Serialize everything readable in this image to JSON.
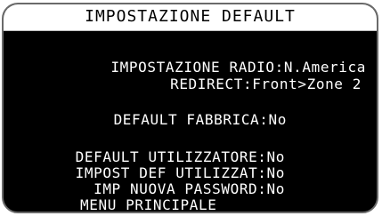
{
  "screen": {
    "title": "IMPOSTAZIONE DEFAULT",
    "items": [
      {
        "label": "IMPOSTAZIONE RADIO:",
        "value": "N.America"
      },
      {
        "label": "REDIRECT:",
        "value": "Front>Zone 2"
      },
      {
        "label": "DEFAULT FABBRICA:",
        "value": "No"
      },
      {
        "label": "DEFAULT UTILIZZATORE:",
        "value": "No"
      },
      {
        "label": "IMPOST DEF UTILIZZAT:",
        "value": "No"
      },
      {
        "label": "IMP NUOVA PASSWORD:",
        "value": "No"
      }
    ],
    "menu_label": "MENU PRINCIPALE"
  },
  "colors": {
    "background": "#000000",
    "text": "#ffffff",
    "title_bar": "#ffffff",
    "title_text": "#000000",
    "frame": "#6a6a6a"
  }
}
